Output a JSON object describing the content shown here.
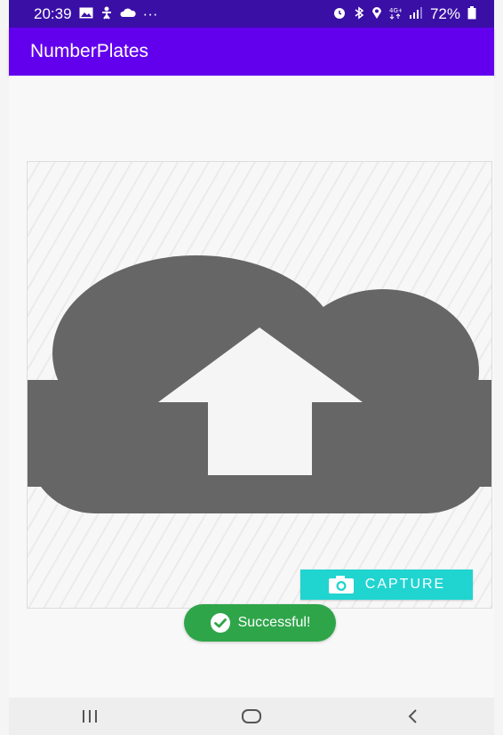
{
  "status_bar": {
    "time": "20:39",
    "left_icons": [
      "gallery-icon",
      "accessibility-icon",
      "cloud-icon"
    ],
    "overflow": "···",
    "right_icons": [
      "alarm-icon",
      "bluetooth-icon",
      "location-icon",
      "network-4g-icon",
      "signal-icon"
    ],
    "battery": "72%"
  },
  "app": {
    "title": "NumberPlates"
  },
  "image_panel": {
    "placeholder_icon": "cloud-upload-icon"
  },
  "capture_button": {
    "label": "CAPTURE",
    "icon": "camera-icon"
  },
  "toast": {
    "message": "Successful!",
    "icon": "check-circle-icon"
  },
  "nav_bar": {
    "buttons": [
      "recent-apps",
      "home",
      "back"
    ]
  },
  "colors": {
    "app_bar": "#6200ee",
    "status_bar": "#3a0fa6",
    "capture": "#20d4d0",
    "toast": "#2fa54a",
    "cloud": "#666666"
  }
}
